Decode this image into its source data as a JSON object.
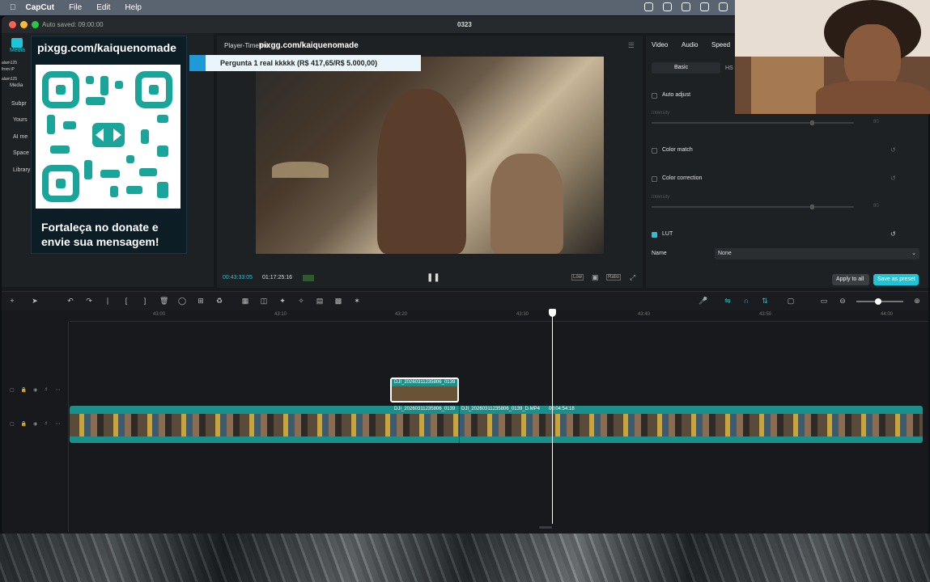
{
  "menubar": {
    "apple": "",
    "app": "CapCut",
    "items": [
      "File",
      "Edit",
      "Help"
    ]
  },
  "window": {
    "autosave": "Auto saved: 09:00:00",
    "project": "0323"
  },
  "left_panel": {
    "items": [
      "Media",
      "Subpr",
      "Yours",
      "AI me",
      "Space",
      "Library"
    ],
    "tiny_labels": [
      "alam125",
      "from iP",
      "alam125",
      "Media"
    ]
  },
  "overlay": {
    "url": "pixgg.com/kaiquenomade",
    "message_line1": "Fortaleça no donate e",
    "message_line2": "envie sua mensagem!"
  },
  "player": {
    "title": "Player-Timeline",
    "title_overlay": "pixgg.com/kaiquenomade",
    "banner": "Pergunta 1 real kkkkk (R$ 417,65/R$ 5.000,00)",
    "current_time": "00:43:33:05",
    "total_time": "01:17:25:16",
    "quality": "Low",
    "ratio": "Ratio"
  },
  "props": {
    "tabs": [
      "Video",
      "Audio",
      "Speed"
    ],
    "subtabs": [
      "Basic",
      "HS"
    ],
    "sections": [
      {
        "label": "Auto adjust",
        "checked": false
      },
      {
        "label": "Intensity",
        "value": "80"
      },
      {
        "label": "Color match",
        "checked": false
      },
      {
        "label": "Color correction",
        "checked": false
      },
      {
        "label": "Intensity",
        "value": "80"
      },
      {
        "label": "LUT",
        "checked": true
      }
    ],
    "name_label": "Name",
    "name_value": "None",
    "apply_all": "Apply to all",
    "save_preset": "Save as preset"
  },
  "timeline": {
    "ruler": [
      "43:00",
      "43:10",
      "43:20",
      "43:30",
      "43:40",
      "43:50",
      "44:00"
    ],
    "clips": {
      "overlay_clip": "DJI_20260311235806_0139",
      "main_clip_a": "DJI_20260311235806_0139",
      "main_clip_b": "DJI_20260311235806_0139_D.MP4",
      "main_clip_b_duration": "00:04:54:18"
    }
  },
  "colors": {
    "accent": "#1ec5d6",
    "track": "#1b8f8a"
  }
}
